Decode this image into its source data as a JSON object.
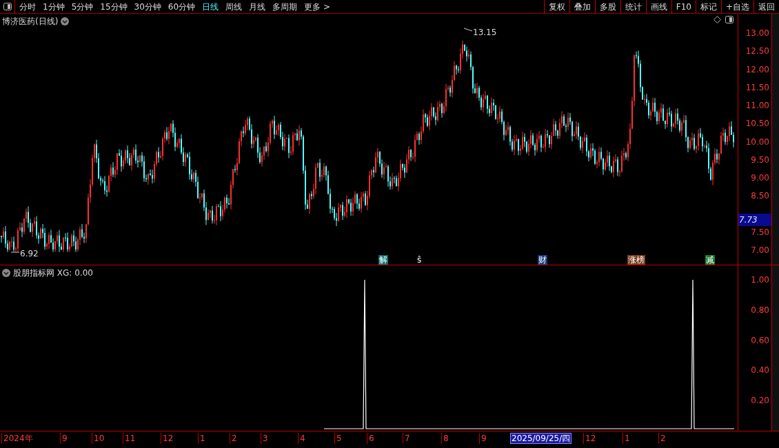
{
  "toolbar": {
    "periods": [
      {
        "label": "分时",
        "selected": false
      },
      {
        "label": "1分钟",
        "selected": false
      },
      {
        "label": "5分钟",
        "selected": false
      },
      {
        "label": "15分钟",
        "selected": false
      },
      {
        "label": "30分钟",
        "selected": false
      },
      {
        "label": "60分钟",
        "selected": false
      },
      {
        "label": "日线",
        "selected": true
      },
      {
        "label": "周线",
        "selected": false
      },
      {
        "label": "月线",
        "selected": false
      },
      {
        "label": "多周期",
        "selected": false
      },
      {
        "label": "更多 >",
        "selected": false
      }
    ],
    "actions": [
      "复权",
      "叠加",
      "多股",
      "统计",
      "画线",
      "F10",
      "标记",
      "+自选",
      "返回"
    ]
  },
  "main_chart": {
    "title": "博济医药(日线)",
    "high_label": "13.15",
    "low_label": "6.92",
    "price_axis": [
      "13.00",
      "12.50",
      "12.00",
      "11.50",
      "11.00",
      "10.50",
      "10.00",
      "9.50",
      "9.00",
      "8.50",
      "7.50",
      "7.00"
    ],
    "current_price": "7.73",
    "event_tags": [
      {
        "label": "解",
        "color": "#0b6d6d"
      },
      {
        "label": "ŝ",
        "color": "#000000"
      },
      {
        "label": "财",
        "color": "#1a3a7a"
      },
      {
        "label": "涨榜",
        "color": "#7a3a1a"
      },
      {
        "label": "减",
        "color": "#1a7a2a"
      }
    ]
  },
  "indicator": {
    "title": "股朋指标网 XG: 0.00",
    "axis": [
      "1.00",
      "0.80",
      "0.60",
      "0.40",
      "0.20"
    ]
  },
  "date_axis": [
    {
      "label": "2024年",
      "kind": "tick"
    },
    {
      "label": "9",
      "kind": "tick"
    },
    {
      "label": "10",
      "kind": "tick"
    },
    {
      "label": "11",
      "kind": "tick"
    },
    {
      "label": "12",
      "kind": "tick"
    },
    {
      "label": "1",
      "kind": "tick"
    },
    {
      "label": "2",
      "kind": "tick"
    },
    {
      "label": "3",
      "kind": "tick"
    },
    {
      "label": "4",
      "kind": "tick"
    },
    {
      "label": "5",
      "kind": "tick"
    },
    {
      "label": "6",
      "kind": "tick"
    },
    {
      "label": "7",
      "kind": "tick"
    },
    {
      "label": "8",
      "kind": "tick"
    },
    {
      "label": "9",
      "kind": "tick"
    },
    {
      "label": "2025/09/25/四",
      "kind": "cursor"
    },
    {
      "label": "12",
      "kind": "tick"
    },
    {
      "label": "1",
      "kind": "tick"
    },
    {
      "label": "2",
      "kind": "tick"
    }
  ]
}
